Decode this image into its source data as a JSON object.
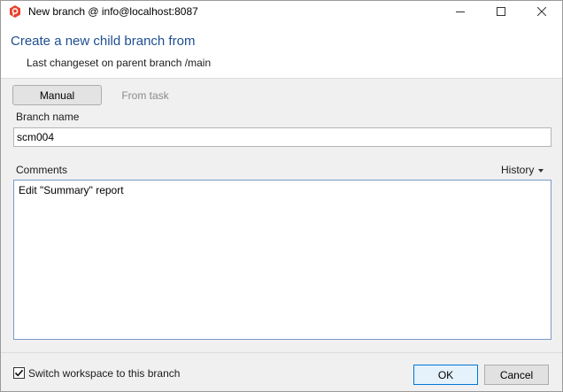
{
  "window": {
    "title": "New branch @ info@localhost:8087"
  },
  "header": {
    "title": "Create a new child branch from",
    "subtitle": "Last changeset on parent branch /main"
  },
  "mode_tabs": {
    "manual_label": "Manual",
    "from_task_label": "From task",
    "selected": "Manual"
  },
  "form": {
    "branch_name_label": "Branch name",
    "branch_name_value": "scm004",
    "comments_label": "Comments",
    "history_label": "History",
    "comments_value": "Edit \"Summary\" report"
  },
  "footer": {
    "switch_workspace_label": "Switch workspace to this branch",
    "switch_workspace_checked": true,
    "ok_label": "OK",
    "cancel_label": "Cancel"
  },
  "colors": {
    "accent": "#1e4e91",
    "app_icon": "#e8412e"
  }
}
